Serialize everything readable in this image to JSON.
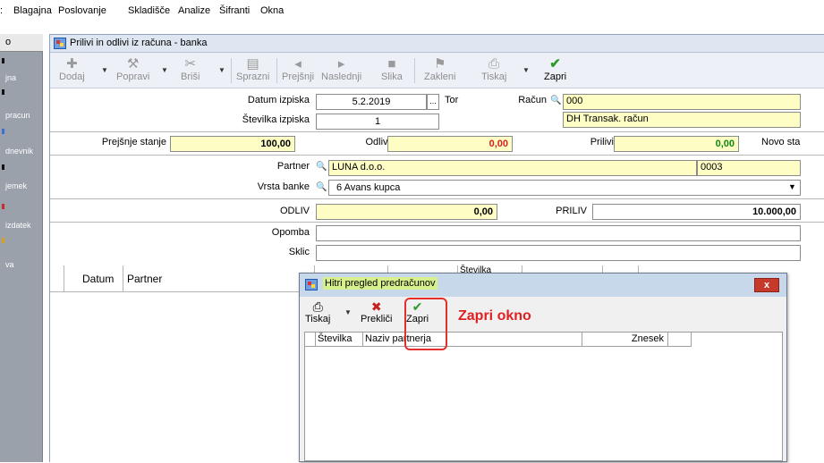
{
  "menu": {
    "cut_item": ":",
    "items": [
      "Blagajna",
      "Poslovanje",
      "Skladišče",
      "Analize",
      "Šifranti",
      "Okna"
    ]
  },
  "sidebar": {
    "top": "o",
    "items": [
      "jna",
      "pracun",
      "dnevnik",
      "jemek",
      "izdatek",
      "va"
    ]
  },
  "window": {
    "title": "Prilivi in odlivi iz računa - banka"
  },
  "toolbar": {
    "dodaj": "Dodaj",
    "popravi": "Popravi",
    "brisi": "Briši",
    "sprazni": "Sprazni",
    "prejsnji": "Prejšnji",
    "naslednji": "Naslednji",
    "slika": "Slika",
    "zakleni": "Zakleni",
    "tiskaj": "Tiskaj",
    "zapri": "Zapri"
  },
  "form": {
    "datum_label": "Datum izpiska",
    "datum_value": "5.2.2019",
    "datum_btn": "...",
    "dan": "Tor",
    "racun_label": "Račun",
    "racun_value": "000",
    "racun_name": "DH Transak. račun",
    "stevilka_label": "Številka izpiska",
    "stevilka_value": "1",
    "prejsnje_label": "Prejšnje stanje",
    "prejsnje_value": "100,00",
    "odlivi_label": "Odlivi",
    "odlivi_value": "0,00",
    "prilivi_label": "Prilivi",
    "prilivi_value": "0,00",
    "novo_label": "Novo sta",
    "partner_label": "Partner",
    "partner_value": "LUNA d.o.o.",
    "partner_code": "0003",
    "vrsta_label": "Vrsta banke",
    "vrsta_value": "6 Avans kupca",
    "odliv_label": "ODLIV",
    "odliv_value": "0,00",
    "priliv_label": "PRILIV",
    "priliv_value": "10.000,00",
    "opomba_label": "Opomba",
    "sklic_label": "Sklic"
  },
  "grid": {
    "columns": [
      "Datum",
      "Partner",
      "Številka"
    ]
  },
  "dialog": {
    "title": "Hitri pregled predračunov",
    "close": "x",
    "tiskaj": "Tiskaj",
    "preklici": "Prekliči",
    "zapri": "Zapri",
    "columns": [
      "Številka",
      "Naziv partnerja",
      "Znesek"
    ]
  },
  "annotation": "Zapri okno",
  "colors": {
    "yellow_field": "#fdfdc4",
    "highlight": "#e4302a",
    "title_highlight": "#d7f08e"
  }
}
